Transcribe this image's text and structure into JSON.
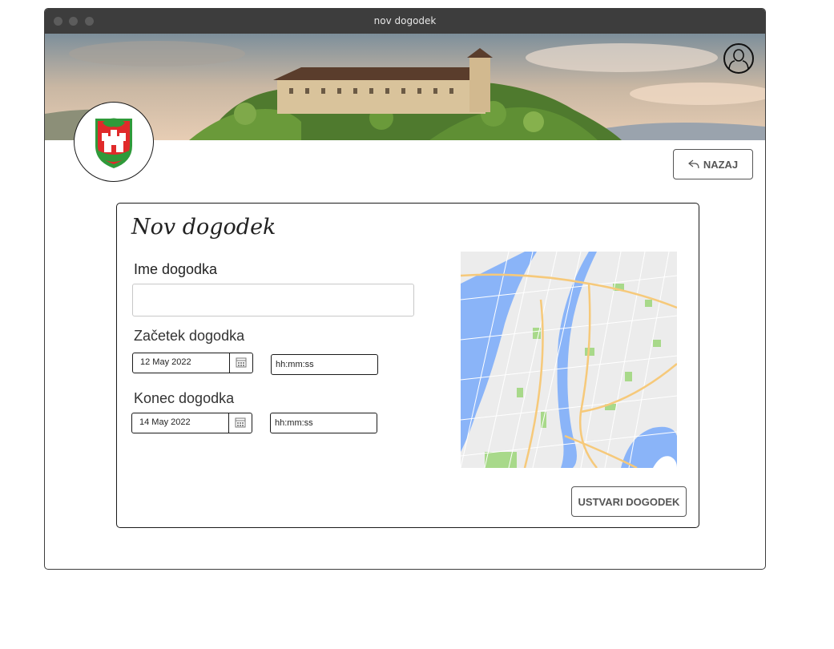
{
  "window": {
    "title": "nov dogodek"
  },
  "header": {
    "back_label": "NAZAJ",
    "icons": {
      "avatar": "user-avatar-icon",
      "back": "reply-arrow-icon",
      "crest": "ljubljana-coat-of-arms"
    }
  },
  "form": {
    "title": "Nov dogodek",
    "name_label": "Ime dogodka",
    "name_value": "",
    "start_label": "Začetek dogodka",
    "start_date": "12 May 2022",
    "start_time": "hh:mm:ss",
    "end_label": "Konec dogodka",
    "end_date": "14 May 2022",
    "end_time": "hh:mm:ss",
    "submit_label": "USTVARI DOGODEK"
  },
  "colors": {
    "titlebar": "#3d3d3d",
    "water": "#8ab4f8",
    "park": "#a8d98a",
    "road": "#f6c97a"
  }
}
